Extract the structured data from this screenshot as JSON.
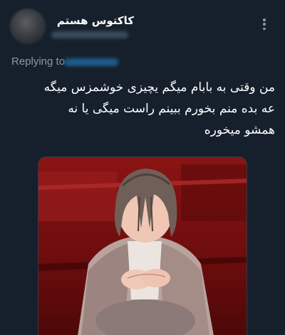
{
  "tweet": {
    "display_name": "کاکتوس هستم",
    "replying_to_label": "Replying to",
    "text_lines": [
      "من وقتی به بابام میگم یچیزی خوشمزس میگه",
      "عه بده منم بخورم ببینم راست میگی یا نه",
      "همشو میخوره"
    ]
  },
  "icons": {
    "more": "more-vertical-icon",
    "avatar": "avatar-blurred"
  },
  "colors": {
    "background": "#16202c",
    "text": "#ffffff",
    "secondary_text": "#8b98a5",
    "image_background_red": "#7d1010"
  }
}
